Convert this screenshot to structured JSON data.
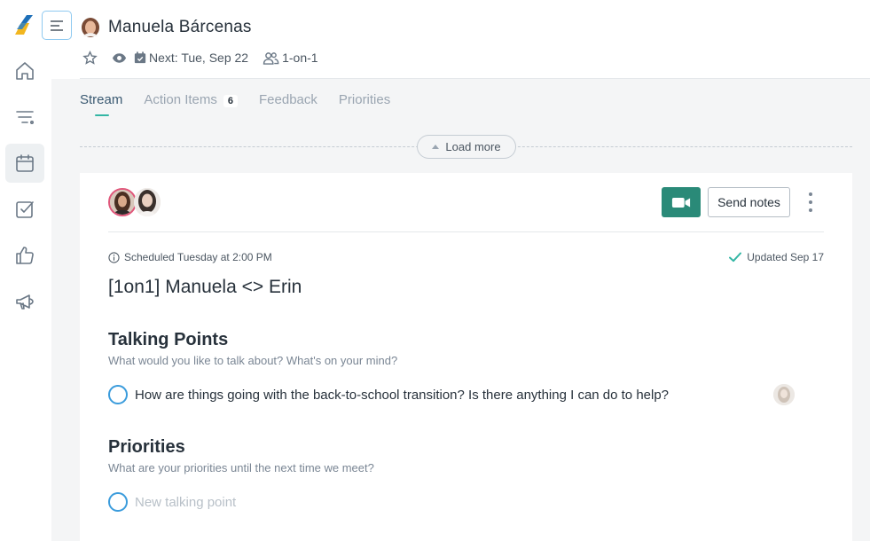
{
  "header": {
    "title": "Manuela Bárcenas",
    "next_meeting": "Next: Tue, Sep 22",
    "meeting_type": "1-on-1"
  },
  "sidebar": {
    "items": [
      {
        "icon": "home-icon"
      },
      {
        "icon": "filter-icon"
      },
      {
        "icon": "calendar-icon",
        "active": true
      },
      {
        "icon": "checkbox-icon"
      },
      {
        "icon": "thumbs-up-icon"
      },
      {
        "icon": "megaphone-icon"
      }
    ]
  },
  "tabs": [
    {
      "label": "Stream",
      "active": true
    },
    {
      "label": "Action Items",
      "badge": "6"
    },
    {
      "label": "Feedback"
    },
    {
      "label": "Priorities"
    }
  ],
  "stream": {
    "load_more_label": "Load more"
  },
  "card": {
    "send_notes_label": "Send notes",
    "scheduled_text": "Scheduled Tuesday at 2:00 PM",
    "updated_text": "Updated Sep 17",
    "meeting_title": "[1on1] Manuela <> Erin",
    "talking_points": {
      "title": "Talking Points",
      "subtitle": "What would you like to talk about? What's on your mind?",
      "items": [
        "How are things going with the back-to-school transition? Is there anything I can do to help?"
      ]
    },
    "priorities": {
      "title": "Priorities",
      "subtitle": "What are your priorities until the next time we meet?",
      "placeholder": "New talking point"
    }
  },
  "colors": {
    "accent_teal": "#33b6a4",
    "video_button": "#2a8a78",
    "checkbox_blue": "#3b9cdc",
    "avatar_ring": "#e0577b"
  }
}
